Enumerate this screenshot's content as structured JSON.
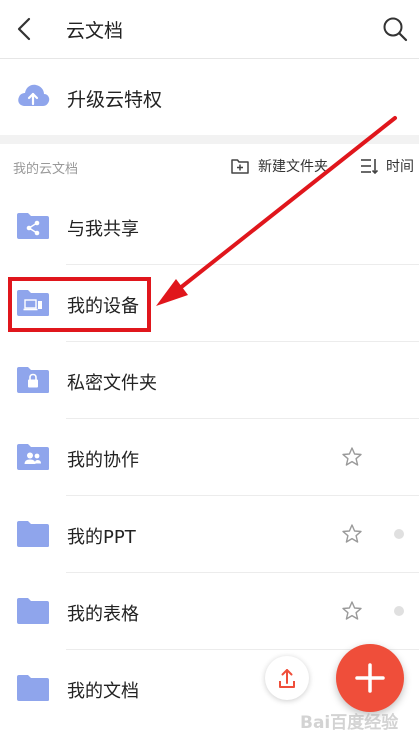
{
  "header": {
    "title": "云文档"
  },
  "upgrade": {
    "label": "升级云特权"
  },
  "section": {
    "title": "我的云文档",
    "new_folder_label": "新建文件夹",
    "sort_label": "时间"
  },
  "items": [
    {
      "label": "与我共享"
    },
    {
      "label": "我的设备"
    },
    {
      "label": "私密文件夹"
    },
    {
      "label": "我的协作"
    },
    {
      "label": "我的PPT"
    },
    {
      "label": "我的表格"
    },
    {
      "label": "我的文档"
    }
  ],
  "colors": {
    "folder": "#8fa5ec",
    "accent_fab": "#ef4e3a",
    "highlight": "#e0161c"
  },
  "watermark": {
    "text": "Bai百度经验"
  }
}
